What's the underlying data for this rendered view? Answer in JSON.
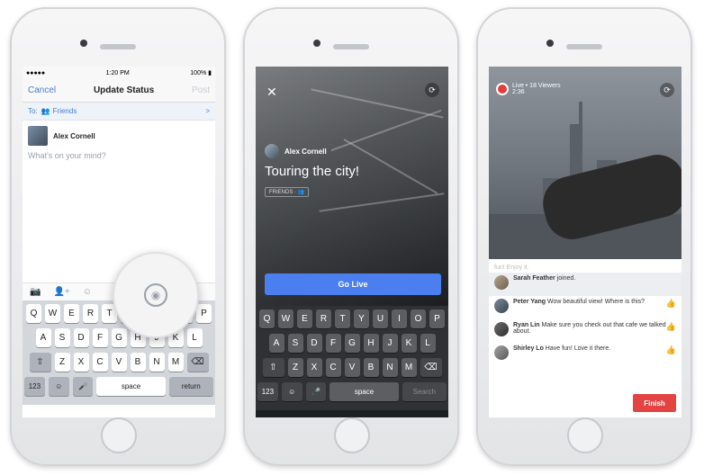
{
  "phone1": {
    "statusbar": {
      "signal": "●●●●● ",
      "time": "1:20 PM",
      "battery": "100% ▮"
    },
    "nav": {
      "cancel": "Cancel",
      "title": "Update Status",
      "post": "Post"
    },
    "to": {
      "prefix": "To:",
      "audience": "Friends",
      "chevron": ">"
    },
    "user": {
      "name": "Alex Cornell"
    },
    "composer": {
      "placeholder": "What's on your mind?"
    },
    "tools": [
      "📷",
      "👤+",
      "☺"
    ],
    "keyboard": {
      "row1": [
        "Q",
        "W",
        "E",
        "R",
        "T",
        "Y",
        "U",
        "I",
        "O",
        "P"
      ],
      "row2": [
        "A",
        "S",
        "D",
        "F",
        "G",
        "H",
        "J",
        "K",
        "L"
      ],
      "row3": [
        "⇧",
        "Z",
        "X",
        "C",
        "V",
        "B",
        "N",
        "M",
        "⌫"
      ],
      "num": "123",
      "emoji": "☺",
      "mic": "🎤",
      "space": "space",
      "return": "return"
    }
  },
  "phone2": {
    "close": "✕",
    "flip": "⟳",
    "user": {
      "name": "Alex Cornell"
    },
    "caption": "Touring the city!",
    "audience": "FRIENDS · 👥",
    "go_live": "Go Live",
    "keyboard": {
      "row1": [
        "Q",
        "W",
        "E",
        "R",
        "T",
        "Y",
        "U",
        "I",
        "O",
        "P"
      ],
      "row2": [
        "A",
        "S",
        "D",
        "F",
        "G",
        "H",
        "J",
        "K",
        "L"
      ],
      "row3": [
        "⇧",
        "Z",
        "X",
        "C",
        "V",
        "B",
        "N",
        "M",
        "⌫"
      ],
      "num": "123",
      "emoji": "☺",
      "mic": "🎤",
      "space": "space",
      "search": "Search"
    }
  },
  "phone3": {
    "live": "Live • 18 Viewers",
    "live_time": "2:36",
    "flip": "⟳",
    "faded_comment": "fun! Enjoy it.",
    "comments": [
      {
        "name": "Sarah Feather",
        "text": "joined.",
        "highlight": true,
        "like": "",
        "liked": false
      },
      {
        "name": "Peter Yang",
        "text": "Wow beautiful view! Where is this?",
        "highlight": false,
        "like": "👍",
        "liked": true
      },
      {
        "name": "Ryan Lin",
        "text": "Make sure you check out that cafe we talked about.",
        "highlight": false,
        "like": "👍",
        "liked": false
      },
      {
        "name": "Shirley Lo",
        "text": "Have fun! Love it there.",
        "highlight": false,
        "like": "👍",
        "liked": false
      }
    ],
    "finish": "Finish"
  }
}
